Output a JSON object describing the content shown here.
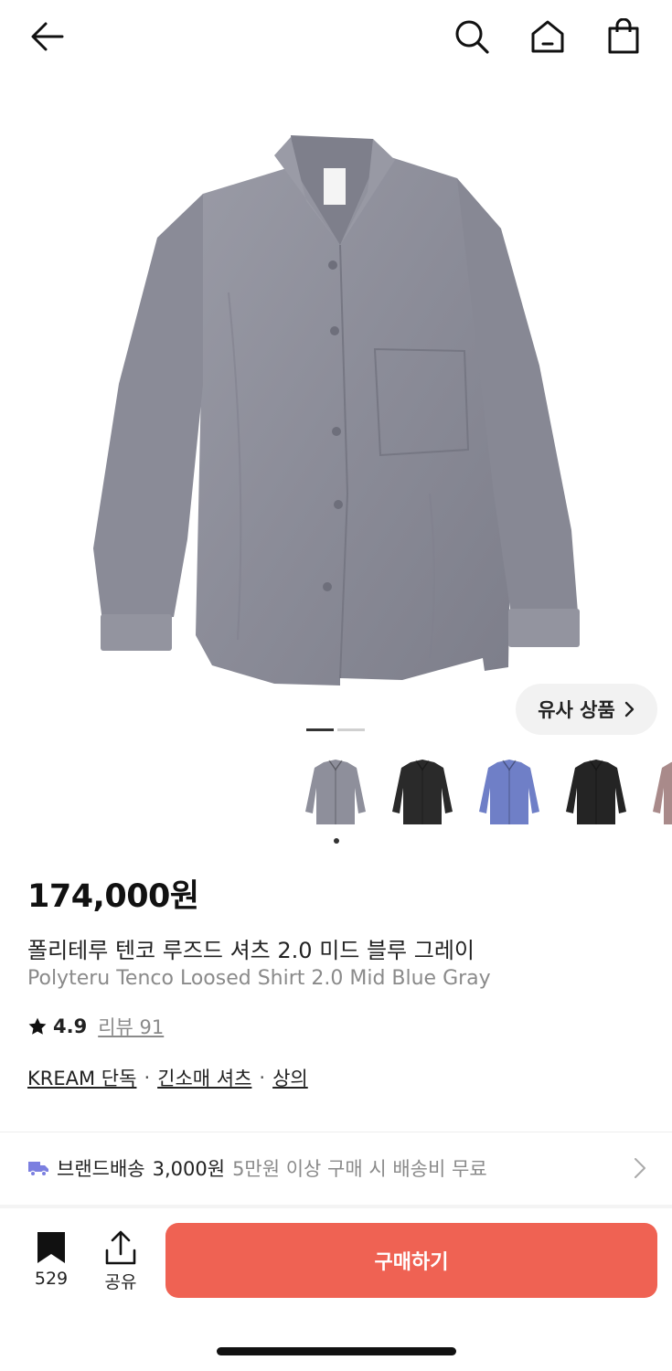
{
  "header": {
    "back_icon": "arrow-left-icon",
    "search_icon": "search-icon",
    "home_icon": "home-icon",
    "bag_icon": "shopping-bag-icon"
  },
  "gallery": {
    "similar_label": "유사 상품",
    "current_slide": 1,
    "total_slides": 2,
    "thumbnails": [
      {
        "color": "#8e8f9b",
        "selected": true
      },
      {
        "color": "#2a2a2a",
        "selected": false
      },
      {
        "color": "#6f7fc7",
        "selected": false
      },
      {
        "color": "#242424",
        "selected": false
      },
      {
        "color": "#a98a8a",
        "selected": false
      }
    ]
  },
  "product": {
    "price": "174,000원",
    "name_ko": "폴리테루 텐코 루즈드 셔츠 2.0 미드 블루 그레이",
    "name_en": "Polyteru Tenco Loosed Shirt 2.0 Mid Blue Gray",
    "rating": "4.9",
    "review_label": "리뷰 91",
    "tags": [
      "KREAM 단독",
      "긴소매 셔츠",
      "상의"
    ],
    "tag_separator": "·"
  },
  "shipping": {
    "label": "브랜드배송",
    "fee": "3,000원",
    "note": "5만원 이상 구매 시 배송비 무료",
    "icon": "truck-icon",
    "icon_color": "#7b7fe0"
  },
  "bottom": {
    "bookmark_count": "529",
    "share_label": "공유",
    "buy_label": "구매하기",
    "buy_color": "#ef6253"
  }
}
